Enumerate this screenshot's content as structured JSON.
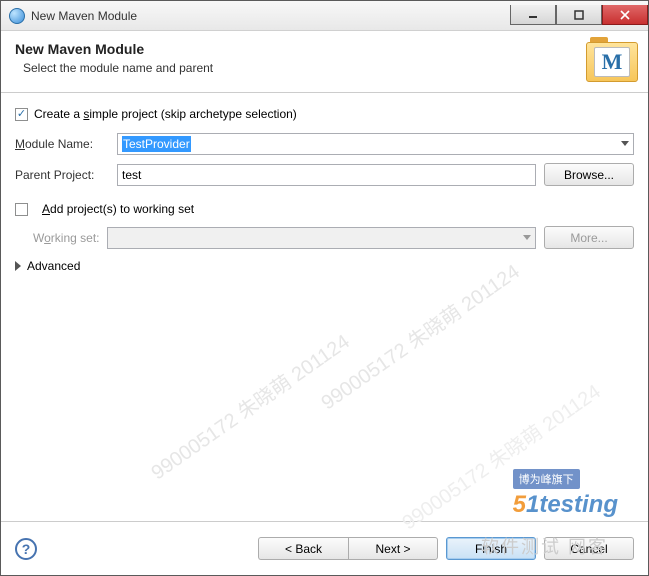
{
  "window": {
    "title": "New Maven Module"
  },
  "header": {
    "title": "New Maven Module",
    "subtitle": "Select the module name and parent",
    "icon_letter": "M"
  },
  "form": {
    "simple_project": {
      "checked": true,
      "label_pre": "Create a ",
      "label_u": "s",
      "label_post": "imple project (skip archetype selection)"
    },
    "module_name": {
      "label_u": "M",
      "label_post": "odule Name:",
      "value": "TestProvider"
    },
    "parent_project": {
      "label": "Parent Project:",
      "value": "test",
      "browse": "Browse..."
    },
    "add_to_ws": {
      "checked": false,
      "label_u": "A",
      "label_post": "dd project(s) to working set"
    },
    "working_set": {
      "label_pre": "W",
      "label_u": "o",
      "label_post": "rking set:",
      "value": "",
      "more": "More..."
    },
    "advanced": {
      "label": "Advanced"
    }
  },
  "footer": {
    "help": "?",
    "back": "< Back",
    "next": "Next >",
    "finish": "Finish",
    "cancel": "Cancel"
  },
  "watermark": {
    "diag": "990005172 朱晓萌 201124",
    "tag": "博为峰旗下",
    "brand_5": "5",
    "brand_1": "1",
    "brand_text": "testing",
    "bottom": "软件测试 网客"
  }
}
